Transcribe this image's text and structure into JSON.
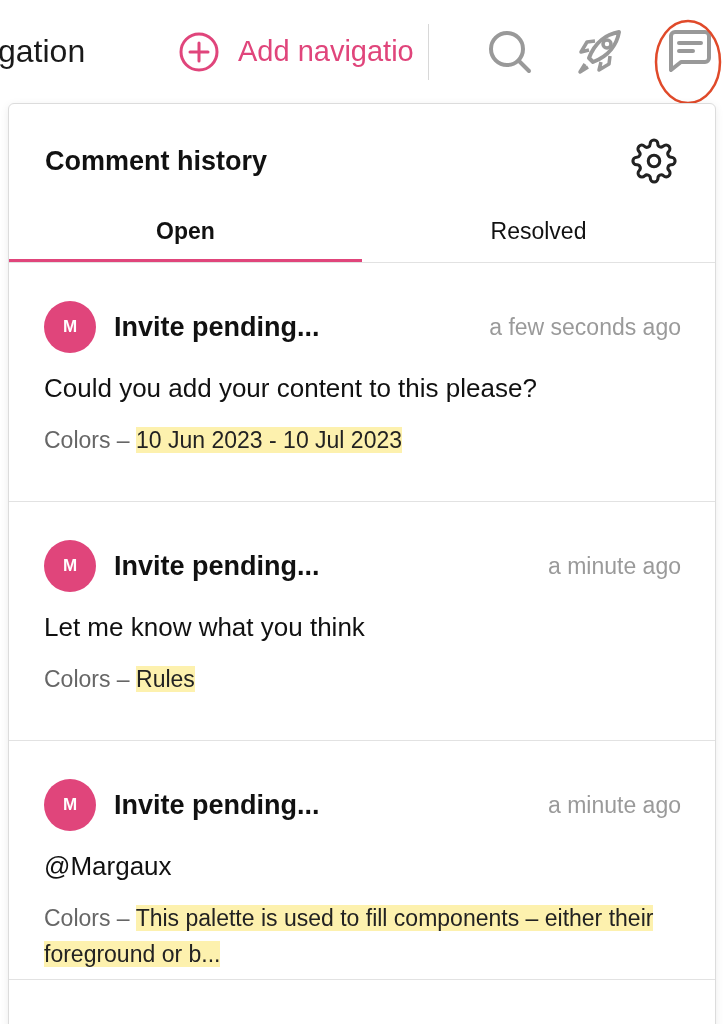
{
  "toolbar": {
    "page_title": "gation",
    "add_link": "Add navigatio"
  },
  "panel": {
    "title": "Comment history",
    "tabs": [
      {
        "label": "Open",
        "selected": true
      },
      {
        "label": "Resolved",
        "selected": false
      }
    ],
    "comments": [
      {
        "avatar": "M",
        "author": "Invite pending...",
        "time": "a few seconds ago",
        "body": "Could you add your content to this please?",
        "section": "Colors –",
        "excerpt": "10 Jun 2023 - 10 Jul 2023"
      },
      {
        "avatar": "M",
        "author": "Invite pending...",
        "time": "a minute ago",
        "body": "Let me know what you think",
        "section": "Colors –",
        "excerpt": "Rules"
      },
      {
        "avatar": "M",
        "author": "Invite pending...",
        "time": "a minute ago",
        "body": "@Margaux",
        "section": "Colors –",
        "excerpt": "This palette is used to fill components – either their foreground or b..."
      }
    ]
  }
}
